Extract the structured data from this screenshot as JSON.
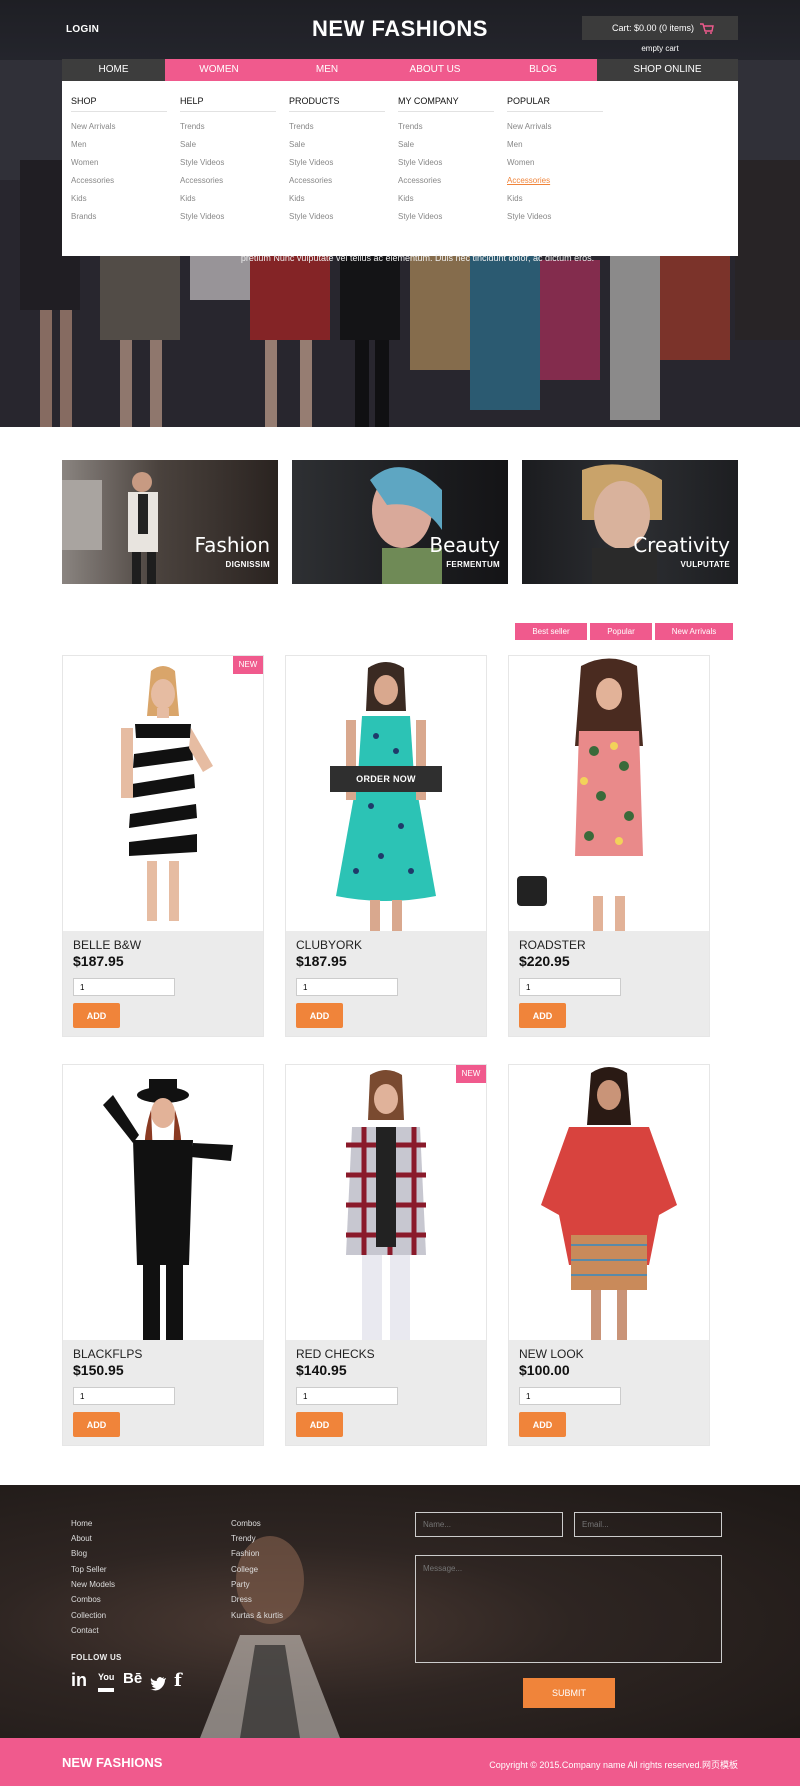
{
  "header": {
    "login": "LOGIN",
    "logo": "NEW FASHIONS",
    "cart": "Cart: $0.00 (0 items)",
    "cart_empty": "empty cart"
  },
  "nav": {
    "items": [
      "HOME",
      "WOMEN",
      "MEN",
      "ABOUT US",
      "BLOG",
      "SHOP ONLINE"
    ]
  },
  "mega_menu": {
    "columns": [
      {
        "title": "SHOP",
        "links": [
          "New Arrivals",
          "Men",
          "Women",
          "Accessories",
          "Kids",
          "Brands"
        ]
      },
      {
        "title": "HELP",
        "links": [
          "Trends",
          "Sale",
          "Style Videos",
          "Accessories",
          "Kids",
          "Style Videos"
        ]
      },
      {
        "title": "PRODUCTS",
        "links": [
          "Trends",
          "Sale",
          "Style Videos",
          "Accessories",
          "Kids",
          "Style Videos"
        ]
      },
      {
        "title": "MY COMPANY",
        "links": [
          "Trends",
          "Sale",
          "Style Videos",
          "Accessories",
          "Kids",
          "Style Videos"
        ]
      },
      {
        "title": "POPULAR",
        "links": [
          "New Arrivals",
          "Men",
          "Women",
          "Accessories",
          "Kids",
          "Style Videos"
        ]
      }
    ],
    "active_link": "Accessories"
  },
  "hero": {
    "text": "pretium Nunc vulputate vel tellus ac elementum. Duis nec tincidunt dolor, ac dictum eros."
  },
  "banners": [
    {
      "title": "Fashion",
      "subtitle": "DIGNISSIM"
    },
    {
      "title": "Beauty",
      "subtitle": "FERMENTUM"
    },
    {
      "title": "Creativity",
      "subtitle": "VULPUTATE"
    }
  ],
  "filters": [
    "Best seller",
    "Popular",
    "New Arrivals"
  ],
  "products": [
    {
      "name": "BELLE B&W",
      "price": "$187.95",
      "qty": "1",
      "add": "ADD",
      "badge": "NEW"
    },
    {
      "name": "CLUBYORK",
      "price": "$187.95",
      "qty": "1",
      "add": "ADD",
      "overlay": "ORDER NOW"
    },
    {
      "name": "ROADSTER",
      "price": "$220.95",
      "qty": "1",
      "add": "ADD"
    },
    {
      "name": "BLACKFLPS",
      "price": "$150.95",
      "qty": "1",
      "add": "ADD"
    },
    {
      "name": "RED CHECKS",
      "price": "$140.95",
      "qty": "1",
      "add": "ADD",
      "badge": "NEW"
    },
    {
      "name": "NEW LOOK",
      "price": "$100.00",
      "qty": "1",
      "add": "ADD"
    }
  ],
  "footer": {
    "links_col1": [
      "Home",
      "About",
      "Blog",
      "Top Seller",
      "New Models",
      "Combos",
      "Collection",
      "Contact"
    ],
    "links_col2": [
      "Combos",
      "Trendy",
      "Fashion",
      "College",
      "Party",
      "Dress",
      "Kurtas & kurtis"
    ],
    "follow_us": "FOLLOW US",
    "social": [
      "in",
      "You",
      "Bē",
      "twitter",
      "f"
    ],
    "name_placeholder": "Name...",
    "email_placeholder": "Email...",
    "message_placeholder": "Message...",
    "submit": "SUBMIT"
  },
  "bottom": {
    "logo": "NEW FASHIONS",
    "copyright": "Copyright © 2015.Company name All rights reserved.网页模板"
  },
  "colors": {
    "pink": "#f05a8d",
    "orange": "#f0843a",
    "dark": "#3d3d3d"
  }
}
